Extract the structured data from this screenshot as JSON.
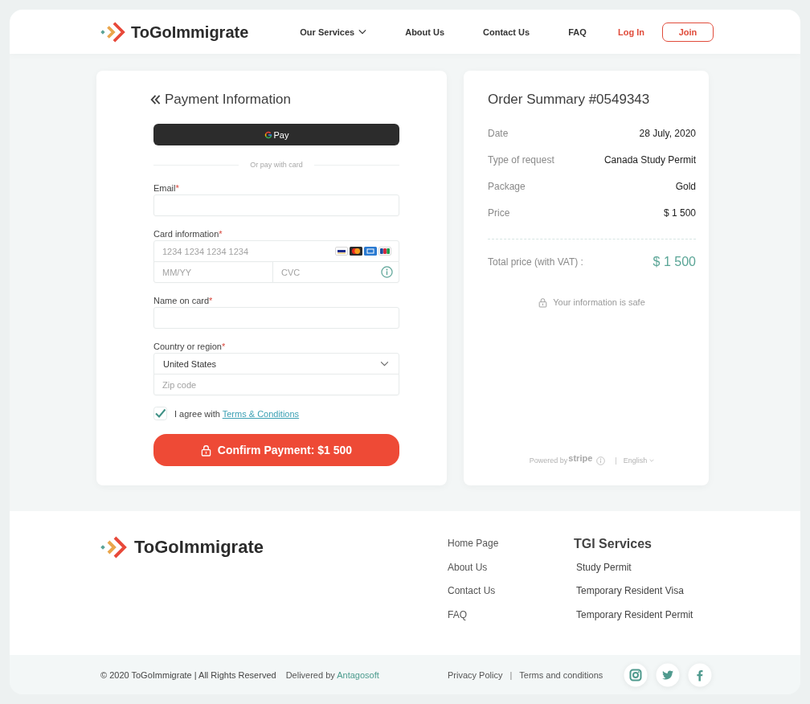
{
  "header": {
    "brand": "ToGoImmigrate",
    "nav": [
      {
        "label": "Our Services",
        "has_menu": true
      },
      {
        "label": "About Us",
        "has_menu": false
      },
      {
        "label": "Contact Us",
        "has_menu": false
      },
      {
        "label": "FAQ",
        "has_menu": false
      }
    ],
    "login": "Log In",
    "join": "Join"
  },
  "payment": {
    "title": "Payment Information",
    "wallet_button": "Pay",
    "divider": "Or pay with card",
    "fields": [
      {
        "kind": "text",
        "label": "Email",
        "required_mark": "*"
      },
      {
        "kind": "card",
        "label": "Card information",
        "required_mark": "*",
        "number_placeholder": "1234 1234 1234 1234",
        "expiry_placeholder": "MM/YY",
        "cvc_placeholder": "CVC"
      },
      {
        "kind": "text",
        "label": "Name on card",
        "required_mark": "*"
      },
      {
        "kind": "address",
        "label": "Country or region",
        "required_mark": "*",
        "country": "United States",
        "zip_placeholder": "Zip code"
      }
    ],
    "agreement": {
      "checked": true,
      "text": "I agree with",
      "link": "Terms & Conditions"
    },
    "confirm_button": "Confirm Payment: $1 500"
  },
  "order_summary": {
    "title": "Order Summary #0549343",
    "rows": [
      {
        "label": "Date",
        "value": "28 July, 2020"
      },
      {
        "label": "Type of request",
        "value": "Canada Study Permit"
      },
      {
        "label": "Package",
        "value": "Gold"
      },
      {
        "label": "Price",
        "value": "$ 1 500"
      }
    ],
    "total": {
      "label": "Total price (with VAT) :",
      "value": "$ 1 500"
    },
    "safe_note": "Your information is safe",
    "powered_by": "Powered by",
    "processor": "stripe",
    "separator": "|",
    "language": "English"
  },
  "footer": {
    "brand": "ToGoImmigrate",
    "links": [
      "Home Page",
      "About Us",
      "Contact Us",
      "FAQ"
    ],
    "services_title": "TGI Services",
    "services": [
      "Study Permit",
      "Temporary Resident Visa",
      "Temporary Resident Permit"
    ]
  },
  "bottom_bar": {
    "copyright": "© 2020 ToGoImmigrate | All Rights Reserved",
    "delivered_by": "Delivered by",
    "company": "Antagosoft",
    "legal_links": [
      "Privacy Policy",
      "Terms and conditions"
    ],
    "separator": "|"
  }
}
